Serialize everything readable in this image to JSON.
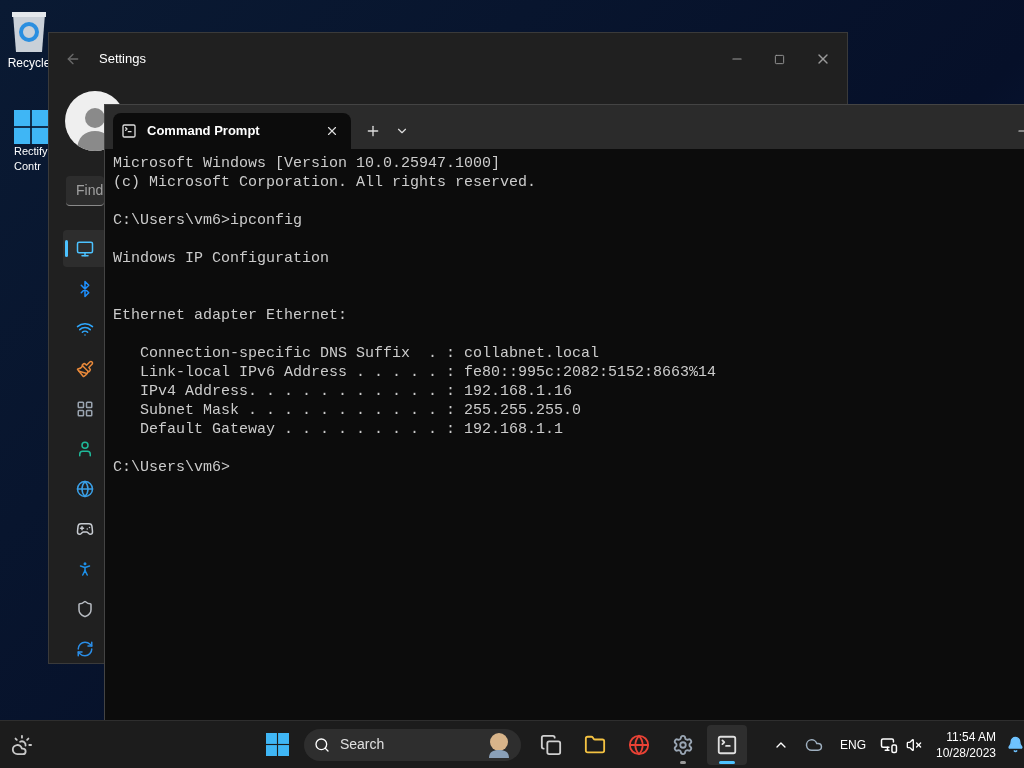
{
  "desktop_icons": [
    {
      "label_lines": [
        "Recycle"
      ]
    },
    {
      "label_lines": [
        "Rectify",
        "Contr"
      ]
    }
  ],
  "settings": {
    "title": "Settings",
    "search": {
      "placeholder": "Find"
    },
    "nav_items": [
      {
        "selected": true
      },
      {
        "selected": false
      },
      {
        "selected": false
      },
      {
        "selected": false
      },
      {
        "selected": false
      },
      {
        "selected": false
      },
      {
        "selected": false
      },
      {
        "selected": false
      },
      {
        "selected": false
      },
      {
        "selected": false
      },
      {
        "selected": false
      }
    ]
  },
  "terminal": {
    "tabs": [
      {
        "title": "Command Prompt",
        "selected": true
      }
    ],
    "blocks": [
      {
        "kind": "start",
        "lines": [
          "Microsoft Windows [Version 10.0.25947.1000]",
          "(c) Microsoft Corporation. All rights reserved."
        ]
      },
      {
        "kind": "normal",
        "lines": [
          "C:\\Users\\vm6>ipconfig"
        ]
      },
      {
        "kind": "normal",
        "lines": [
          "Windows IP Configuration"
        ]
      },
      {
        "kind": "wide_gap",
        "lines": [
          "Ethernet adapter Ethernet:"
        ]
      },
      {
        "kind": "normal",
        "lines": [
          "   Connection-specific DNS Suffix  . : collabnet.local",
          "   Link-local IPv6 Address . . . . . : fe80::995c:2082:5152:8663%14",
          "   IPv4 Address. . . . . . . . . . . : 192.168.1.16",
          "   Subnet Mask . . . . . . . . . . . : 255.255.255.0",
          "   Default Gateway . . . . . . . . . : 192.168.1.1"
        ]
      },
      {
        "kind": "normal",
        "lines": [
          "C:\\Users\\vm6>"
        ]
      }
    ]
  },
  "taskbar": {
    "search": {
      "placeholder": "Search"
    },
    "apps": [
      {
        "running": false,
        "selected": false
      },
      {
        "running": false,
        "selected": false
      },
      {
        "running": false,
        "selected": false
      },
      {
        "running": true,
        "selected": false
      },
      {
        "running": true,
        "selected": true
      }
    ],
    "language": "ENG",
    "time": "11:54 AM",
    "date": "10/28/2023"
  }
}
